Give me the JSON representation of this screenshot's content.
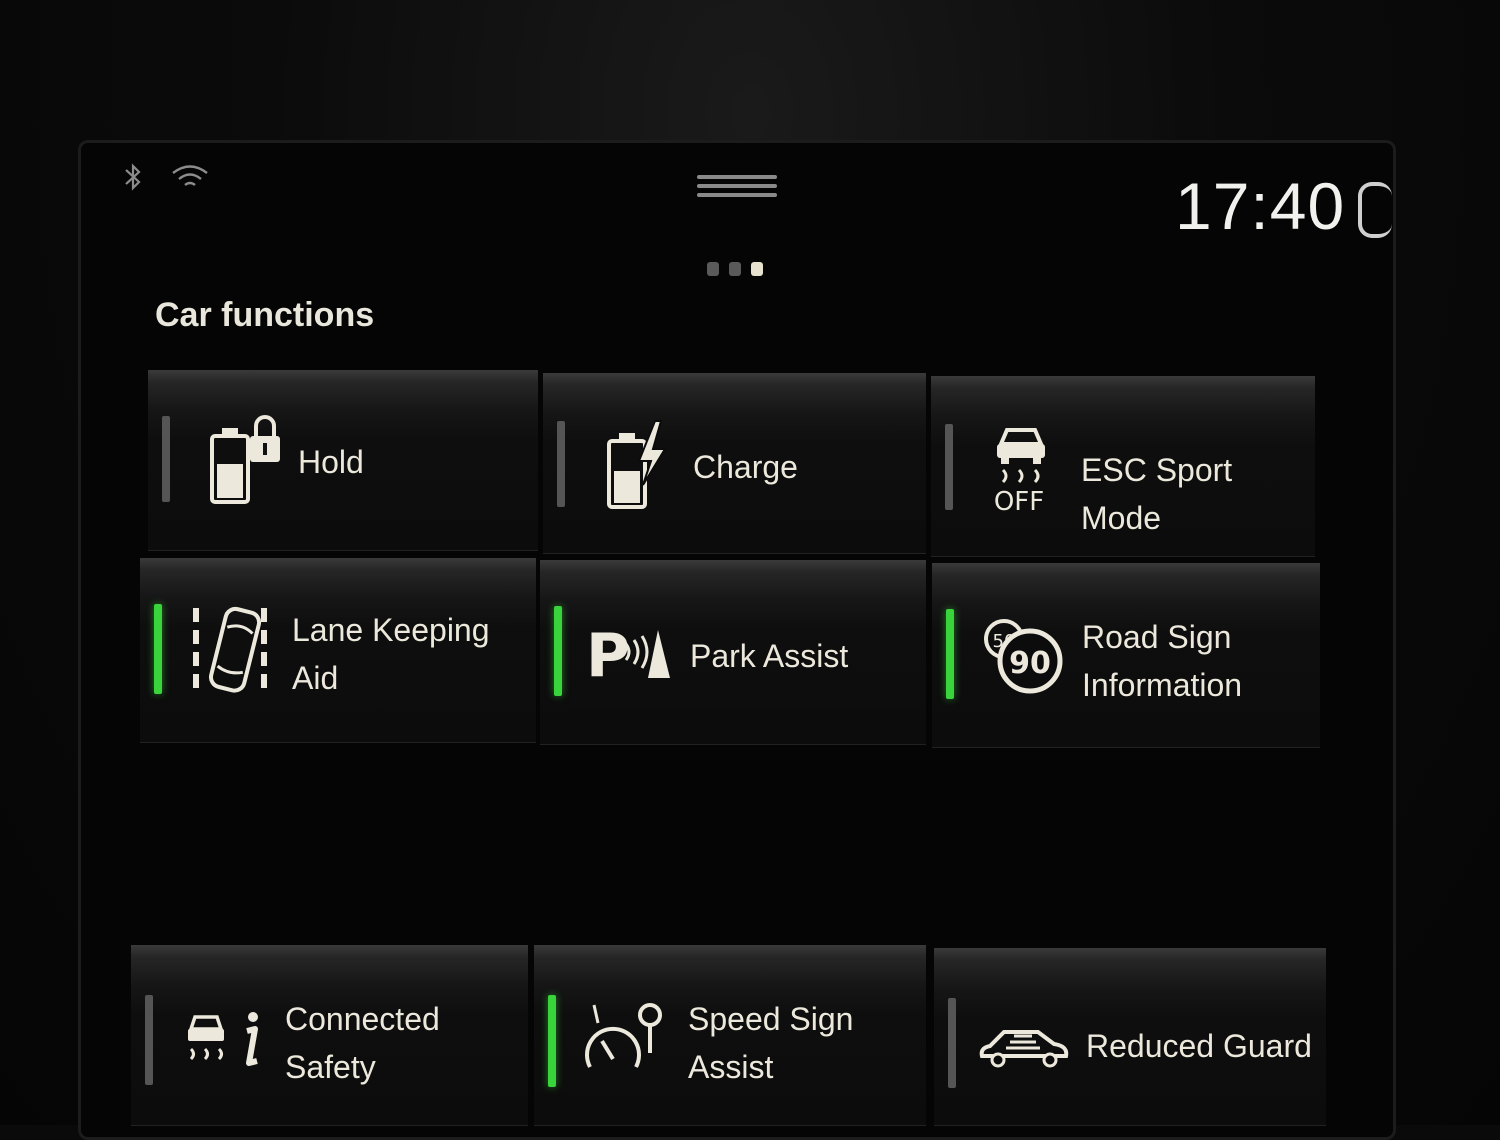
{
  "status_bar": {
    "time": "17:40",
    "icons": [
      "bluetooth-icon",
      "wifi-icon"
    ]
  },
  "pager": {
    "pages": 3,
    "active_page": 3
  },
  "section": {
    "title": "Car functions"
  },
  "tiles": [
    {
      "label": "Hold",
      "active": false,
      "icon": "battery-lock-icon"
    },
    {
      "label": "Charge",
      "active": false,
      "icon": "battery-charge-icon"
    },
    {
      "label": "ESC Sport Mode",
      "active": false,
      "icon": "esc-off-icon",
      "icon_text": "OFF"
    },
    {
      "label": "Lane Keeping\nAid",
      "active": true,
      "icon": "lane-keeping-icon"
    },
    {
      "label": "Park Assist",
      "active": true,
      "icon": "park-assist-icon",
      "icon_text": "P"
    },
    {
      "label": "Road Sign\nInformation",
      "active": true,
      "icon": "road-sign-icon",
      "icon_text": "90",
      "icon_text_small": "50"
    },
    {
      "label": "Connected\nSafety",
      "active": false,
      "icon": "connected-safety-icon"
    },
    {
      "label": "Speed Sign\nAssist",
      "active": true,
      "icon": "speed-sign-assist-icon"
    },
    {
      "label": "Reduced Guard",
      "active": false,
      "icon": "reduced-guard-icon"
    }
  ],
  "colors": {
    "active_indicator": "#39d43b",
    "inactive_indicator": "#555555",
    "text": "#ece8dc"
  }
}
